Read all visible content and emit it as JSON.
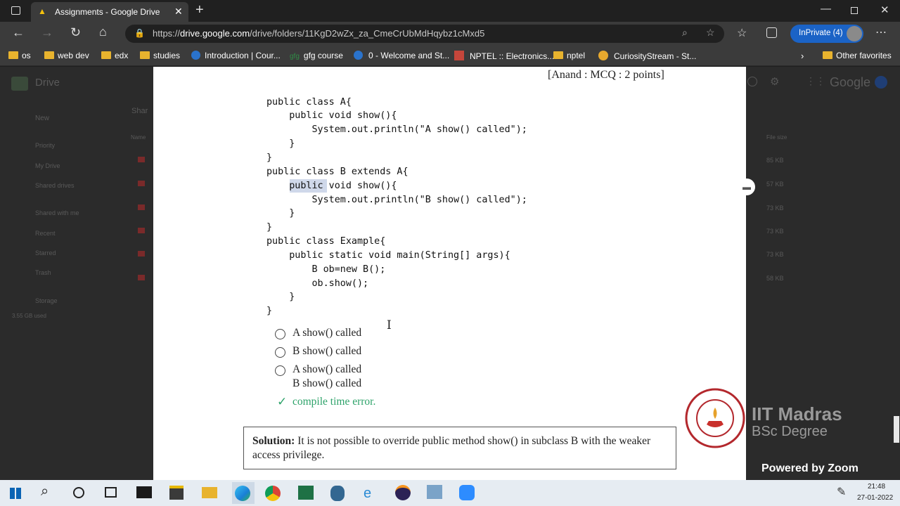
{
  "browser": {
    "tab_title": "Assignments - Google Drive",
    "url_prefix": "https://",
    "url_domain": "drive.google.com",
    "url_path": "/drive/folders/11KgD2wZx_za_CmeCrUbMdHqybz1cMxd5",
    "inprivate_label": "InPrivate (4)"
  },
  "favorites": [
    "os",
    "web dev",
    "edx",
    "studies",
    "Introduction | Cour...",
    "gfg course",
    "0 - Welcome and St...",
    "NPTEL :: Electronics...",
    "nptel",
    "CuriosityStream - St..."
  ],
  "other_favorites": "Other favorites",
  "drive_bg": {
    "title": "Drive",
    "search_hint": "Shar",
    "new_label": "New",
    "nav": [
      "Priority",
      "My Drive",
      "Shared drives",
      "Shared with me",
      "Recent",
      "Starred",
      "Trash",
      "Storage"
    ],
    "storage": "3.55 GB used",
    "column_name": "Name",
    "column_size": "File size",
    "sizes": [
      "85 KB",
      "57 KB",
      "73 KB",
      "73 KB",
      "73 KB",
      "58 KB"
    ],
    "logo": "Google"
  },
  "document": {
    "header": "[Anand : MCQ : 2 points]",
    "code_lines": [
      "public class A{",
      "    public void show(){",
      "        System.out.println(\"A show() called\");",
      "    }",
      "}",
      "public class B extends A{",
      "    public void show(){",
      "        System.out.println(\"B show() called\");",
      "    }",
      "}",
      "public class Example{",
      "    public static void main(String[] args){",
      "        B ob=new B();",
      "        ob.show();",
      "    }",
      "}"
    ],
    "options": [
      "A show() called",
      "B show() called",
      "A show() called",
      "B show() called",
      "compile time error."
    ],
    "solution_label": "Solution:",
    "solution_text": " It is not possible to override public method show() in subclass B with the weaker access privilege."
  },
  "overlay": {
    "institute": "IIT Madras",
    "degree": "BSc Degree",
    "powered": "Powered by Zoom",
    "emblem_text": "INDIAN INSTITUTE OF TECHNOLOGY MADRAS"
  },
  "taskbar": {
    "time": "21:48",
    "date": "27-01-2022"
  },
  "colors": {
    "correct": "#2ea36a",
    "inprivate": "#1b63c6",
    "folder": "#e8b32e"
  }
}
